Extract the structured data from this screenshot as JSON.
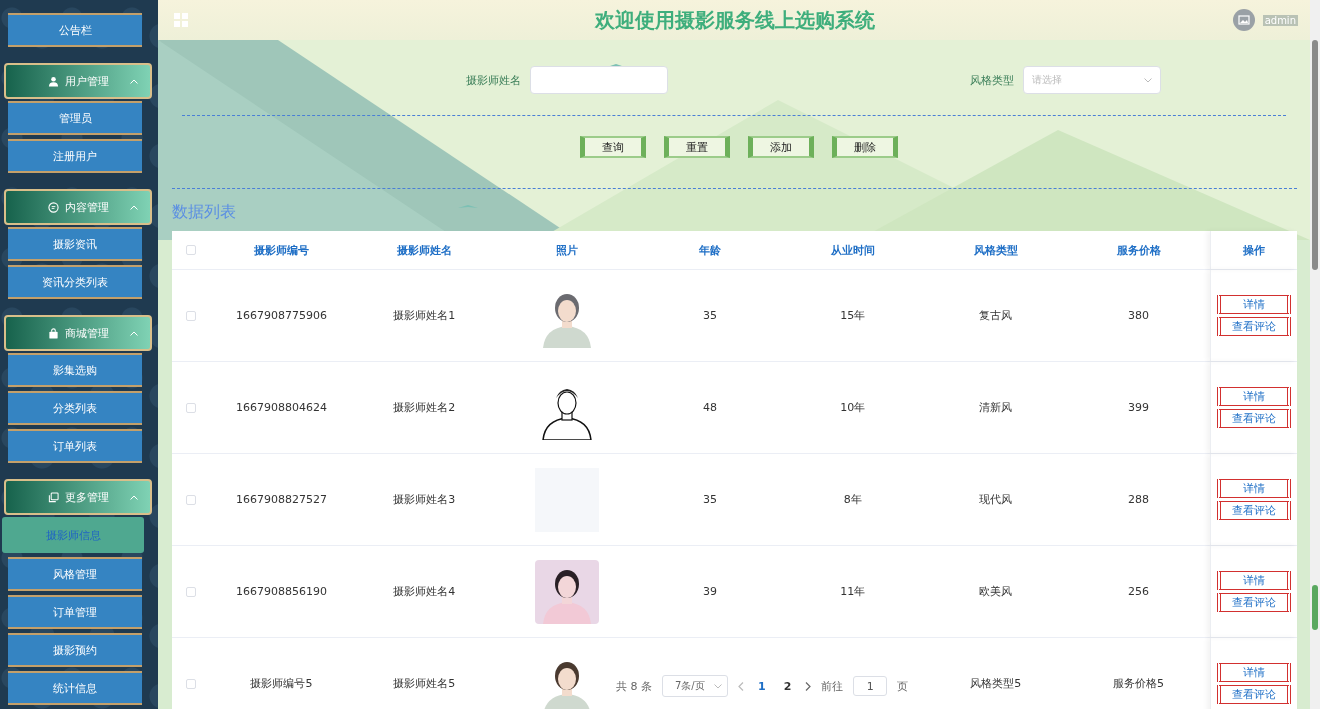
{
  "header": {
    "title": "欢迎使用摄影服务线上选购系统",
    "user": "admin"
  },
  "sidebar": {
    "items": [
      {
        "kind": "item",
        "label": "公告栏",
        "selected": false
      },
      {
        "kind": "group",
        "label": "用户管理",
        "expanded": true
      },
      {
        "kind": "item",
        "label": "管理员",
        "selected": false
      },
      {
        "kind": "item",
        "label": "注册用户",
        "selected": false
      },
      {
        "kind": "group",
        "label": "内容管理",
        "expanded": true
      },
      {
        "kind": "item",
        "label": "摄影资讯",
        "selected": false
      },
      {
        "kind": "item",
        "label": "资讯分类列表",
        "selected": false
      },
      {
        "kind": "group",
        "label": "商城管理",
        "expanded": true
      },
      {
        "kind": "item",
        "label": "影集选购",
        "selected": false
      },
      {
        "kind": "item",
        "label": "分类列表",
        "selected": false
      },
      {
        "kind": "item",
        "label": "订单列表",
        "selected": false
      },
      {
        "kind": "group",
        "label": "更多管理",
        "expanded": true
      },
      {
        "kind": "item",
        "label": "摄影师信息",
        "selected": true
      },
      {
        "kind": "item",
        "label": "风格管理",
        "selected": false
      },
      {
        "kind": "item",
        "label": "订单管理",
        "selected": false
      },
      {
        "kind": "item",
        "label": "摄影预约",
        "selected": false
      },
      {
        "kind": "item",
        "label": "统计信息",
        "selected": false
      }
    ]
  },
  "search": {
    "fields": [
      {
        "kind": "text",
        "label": "摄影师姓名"
      },
      {
        "kind": "select",
        "label": "风格类型",
        "placeholder": "请选择"
      }
    ],
    "buttons": [
      "查询",
      "重置",
      "添加",
      "删除"
    ]
  },
  "section_title": "数据列表",
  "table": {
    "all_checked": false,
    "columns": [
      "摄影师编号",
      "摄影师姓名",
      "照片",
      "年龄",
      "从业时间",
      "风格类型",
      "服务价格",
      "操作"
    ],
    "rows": [
      {
        "checked": false,
        "id": "1667908775906",
        "name": "摄影师姓名1",
        "age": "35",
        "years": "15年",
        "style": "复古风",
        "price": "380",
        "actions": [
          "详情",
          "查看评论"
        ]
      },
      {
        "checked": false,
        "id": "1667908804624",
        "name": "摄影师姓名2",
        "age": "48",
        "years": "10年",
        "style": "清新风",
        "price": "399",
        "actions": [
          "详情",
          "查看评论"
        ]
      },
      {
        "checked": false,
        "id": "1667908827527",
        "name": "摄影师姓名3",
        "photo": {
          "kind": "empty"
        },
        "age": "35",
        "years": "8年",
        "style": "现代风",
        "price": "288",
        "actions": [
          "详情",
          "查看评论"
        ]
      },
      {
        "checked": false,
        "id": "1667908856190",
        "name": "摄影师姓名4",
        "age": "39",
        "years": "11年",
        "style": "欧美风",
        "price": "256",
        "actions": [
          "详情",
          "查看评论"
        ]
      },
      {
        "checked": false,
        "id": "摄影师编号5",
        "name": "摄影师姓名5",
        "style": "风格类型5",
        "price": "服务价格5",
        "actions": [
          "详情",
          "查看评论"
        ]
      }
    ]
  },
  "pagination": {
    "total": "共 8 条",
    "page_size": "7条/页",
    "pages": [
      {
        "label": "1",
        "selected": true
      },
      {
        "label": "2",
        "selected": false
      }
    ],
    "goto_label": "前往",
    "goto_value": "1",
    "goto_suffix": "页"
  }
}
